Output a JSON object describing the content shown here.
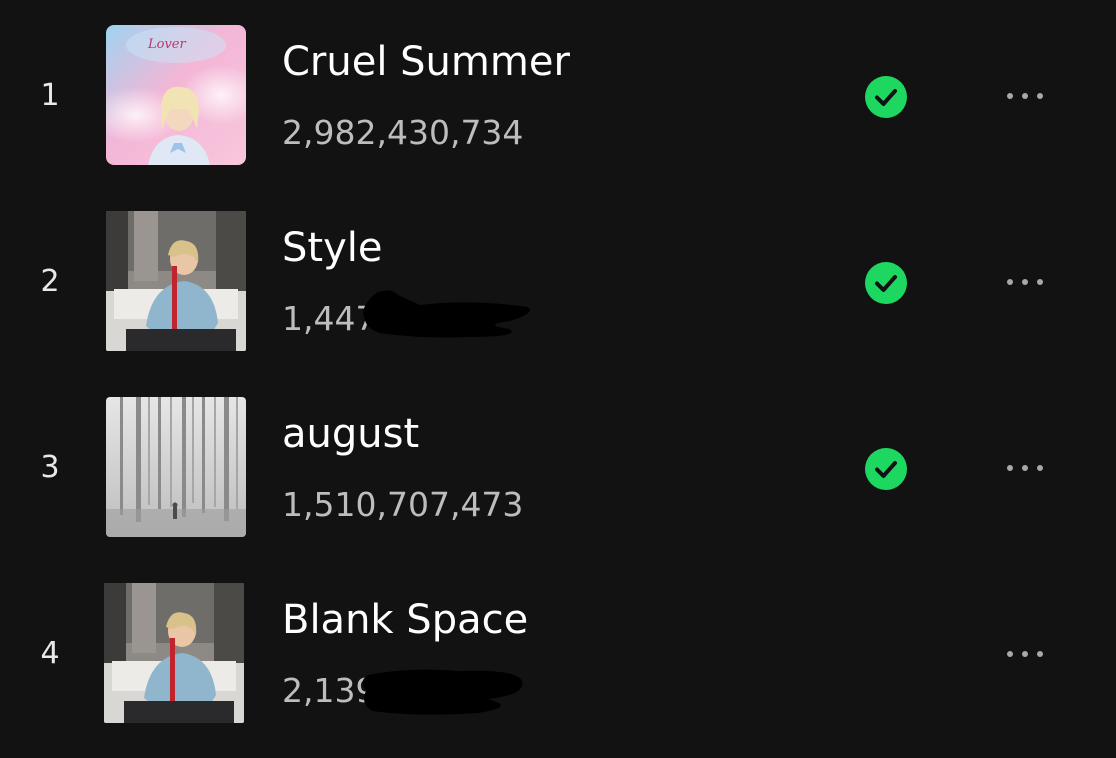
{
  "tracks": [
    {
      "number": "1",
      "title": "Cruel Summer",
      "streams": "2,982,430,734",
      "saved": true,
      "cover": "lover-album-cover",
      "cover_text": "Lover"
    },
    {
      "number": "2",
      "title": "Style",
      "streams": "1,447",
      "saved": true,
      "cover": "1989-album-cover"
    },
    {
      "number": "3",
      "title": "august",
      "streams": "1,510,707,473",
      "saved": true,
      "cover": "folklore-album-cover"
    },
    {
      "number": "4",
      "title": "Blank Space",
      "streams": "2,139",
      "saved": false,
      "cover": "1989-album-cover"
    }
  ],
  "icons": {
    "saved": "check-circle-icon",
    "more": "more-options-icon"
  },
  "colors": {
    "background": "#121212",
    "accent": "#1ed760",
    "secondary_text": "#bdbdbd"
  }
}
